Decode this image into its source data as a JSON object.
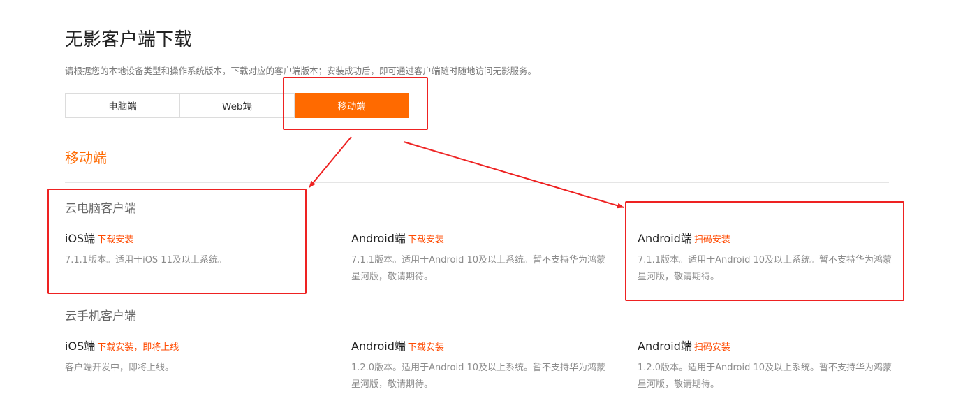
{
  "header": {
    "title": "无影客户端下载",
    "description": "请根据您的本地设备类型和操作系统版本，下载对应的客户端版本；安装成功后，即可通过客户端随时随地访问无影服务。"
  },
  "tabs": [
    {
      "label": "电脑端",
      "active": false
    },
    {
      "label": "Web端",
      "active": false
    },
    {
      "label": "移动端",
      "active": true
    }
  ],
  "section": {
    "title": "移动端"
  },
  "groups": [
    {
      "title": "云电脑客户端",
      "items": [
        {
          "platform": "iOS端",
          "action": "下载安装",
          "desc": "7.1.1版本。适用于iOS 11及以上系统。"
        },
        {
          "platform": "Android端",
          "action": "下载安装",
          "desc": "7.1.1版本。适用于Android 10及以上系统。暂不支持华为鸿蒙星河版，敬请期待。"
        },
        {
          "platform": "Android端",
          "action": "扫码安装",
          "desc": "7.1.1版本。适用于Android 10及以上系统。暂不支持华为鸿蒙星河版，敬请期待。"
        }
      ]
    },
    {
      "title": "云手机客户端",
      "items": [
        {
          "platform": "iOS端",
          "action": "下载安装，即将上线",
          "desc": "客户端开发中，即将上线。"
        },
        {
          "platform": "Android端",
          "action": "下载安装",
          "desc": "1.2.0版本。适用于Android 10及以上系统。暂不支持华为鸿蒙星河版，敬请期待。"
        },
        {
          "platform": "Android端",
          "action": "扫码安装",
          "desc": "1.2.0版本。适用于Android 10及以上系统。暂不支持华为鸿蒙星河版，敬请期待。"
        }
      ]
    }
  ],
  "colors": {
    "accent": "#ff6a00",
    "link": "#ff4a00",
    "annotation": "#ee2222"
  }
}
